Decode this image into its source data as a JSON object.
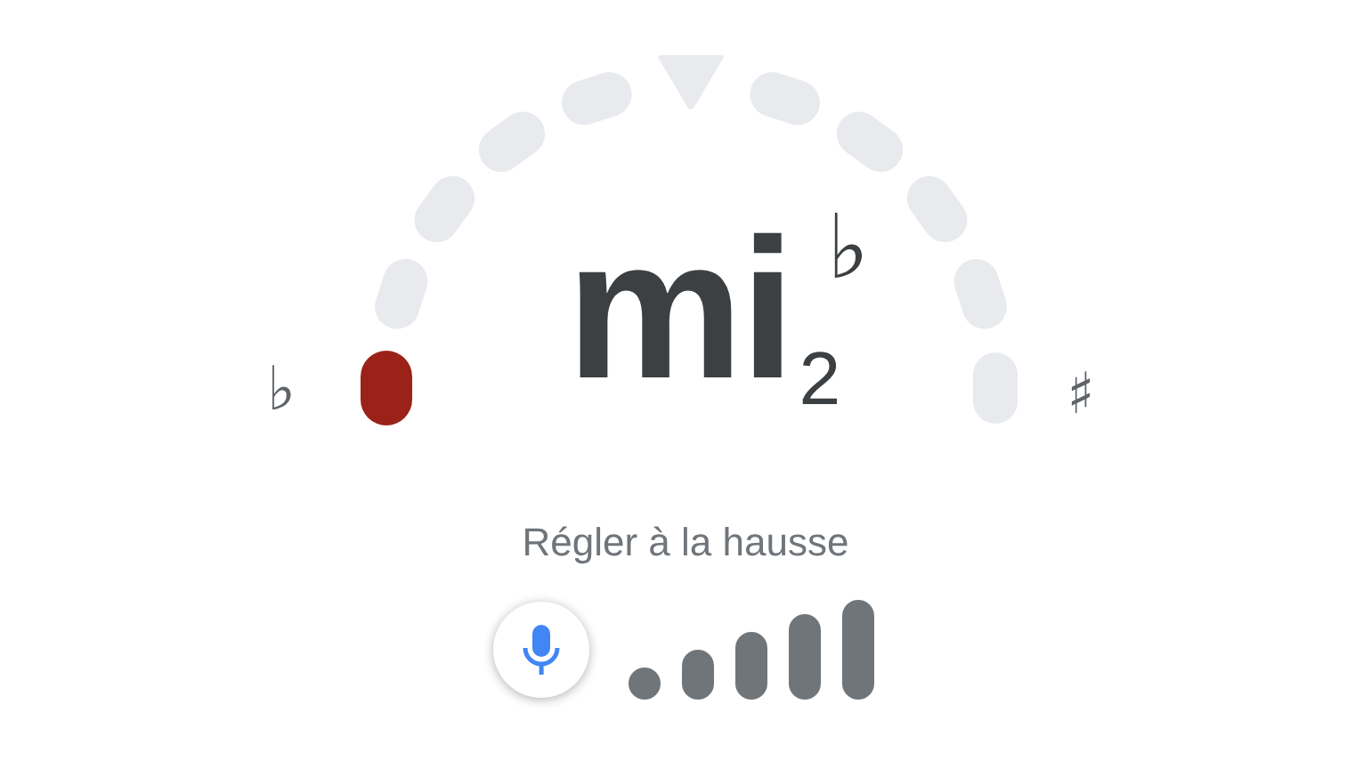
{
  "tuner": {
    "flat_sign": "♭",
    "sharp_sign": "♯",
    "segments": [
      {
        "lit": true
      },
      {
        "lit": false
      },
      {
        "lit": false
      },
      {
        "lit": false
      },
      {
        "lit": false
      },
      {
        "lit": false
      },
      {
        "lit": false
      },
      {
        "lit": false
      },
      {
        "lit": false
      },
      {
        "lit": false
      }
    ],
    "note": {
      "name": "mi",
      "accidental": "♭",
      "octave": "2"
    }
  },
  "hint": "Régler à la hausse"
}
